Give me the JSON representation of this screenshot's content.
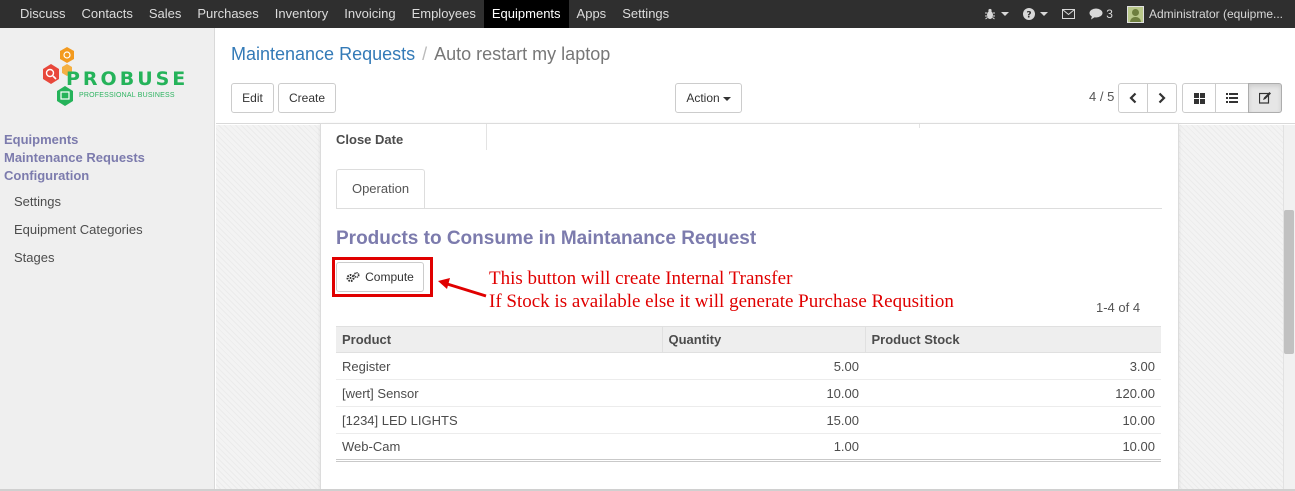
{
  "topnav": {
    "items": [
      "Discuss",
      "Contacts",
      "Sales",
      "Purchases",
      "Inventory",
      "Invoicing",
      "Employees",
      "Equipments",
      "Apps",
      "Settings"
    ],
    "active": "Equipments",
    "messages_count": "3",
    "user": "Administrator (equipme..."
  },
  "logo": {
    "name": "PROBUSE",
    "tagline": "PROFESSIONAL BUSINESS"
  },
  "sidebar": {
    "sections": [
      "Equipments",
      "Maintenance Requests",
      "Configuration"
    ],
    "sub_items": [
      "Settings",
      "Equipment Categories",
      "Stages"
    ]
  },
  "breadcrumb": {
    "parent": "Maintenance Requests",
    "current": "Auto restart my laptop"
  },
  "buttons": {
    "edit": "Edit",
    "create": "Create",
    "action": "Action"
  },
  "pager": "4 / 5",
  "form": {
    "close_date_label": "Close Date",
    "tab": "Operation",
    "section_title": "Products to Consume in Maintanance Request",
    "compute_label": "Compute",
    "list_pager": "1-4 of 4",
    "columns": [
      "Product",
      "Quantity",
      "Product Stock"
    ],
    "rows": [
      {
        "product": "Register",
        "quantity": "5.00",
        "stock": "3.00"
      },
      {
        "product": "[wert] Sensor",
        "quantity": "10.00",
        "stock": "120.00"
      },
      {
        "product": "[1234] LED LIGHTS",
        "quantity": "15.00",
        "stock": "10.00"
      },
      {
        "product": "Web-Cam",
        "quantity": "1.00",
        "stock": "10.00"
      }
    ]
  },
  "annotation": {
    "line1": "This button will create Internal Transfer",
    "line2": "If Stock is available else it will generate Purchase Requsition",
    "color": "#e00000"
  },
  "colors": {
    "topbar": "#2f2f2f",
    "accent": "#7c7bad",
    "link": "#337ab7"
  }
}
